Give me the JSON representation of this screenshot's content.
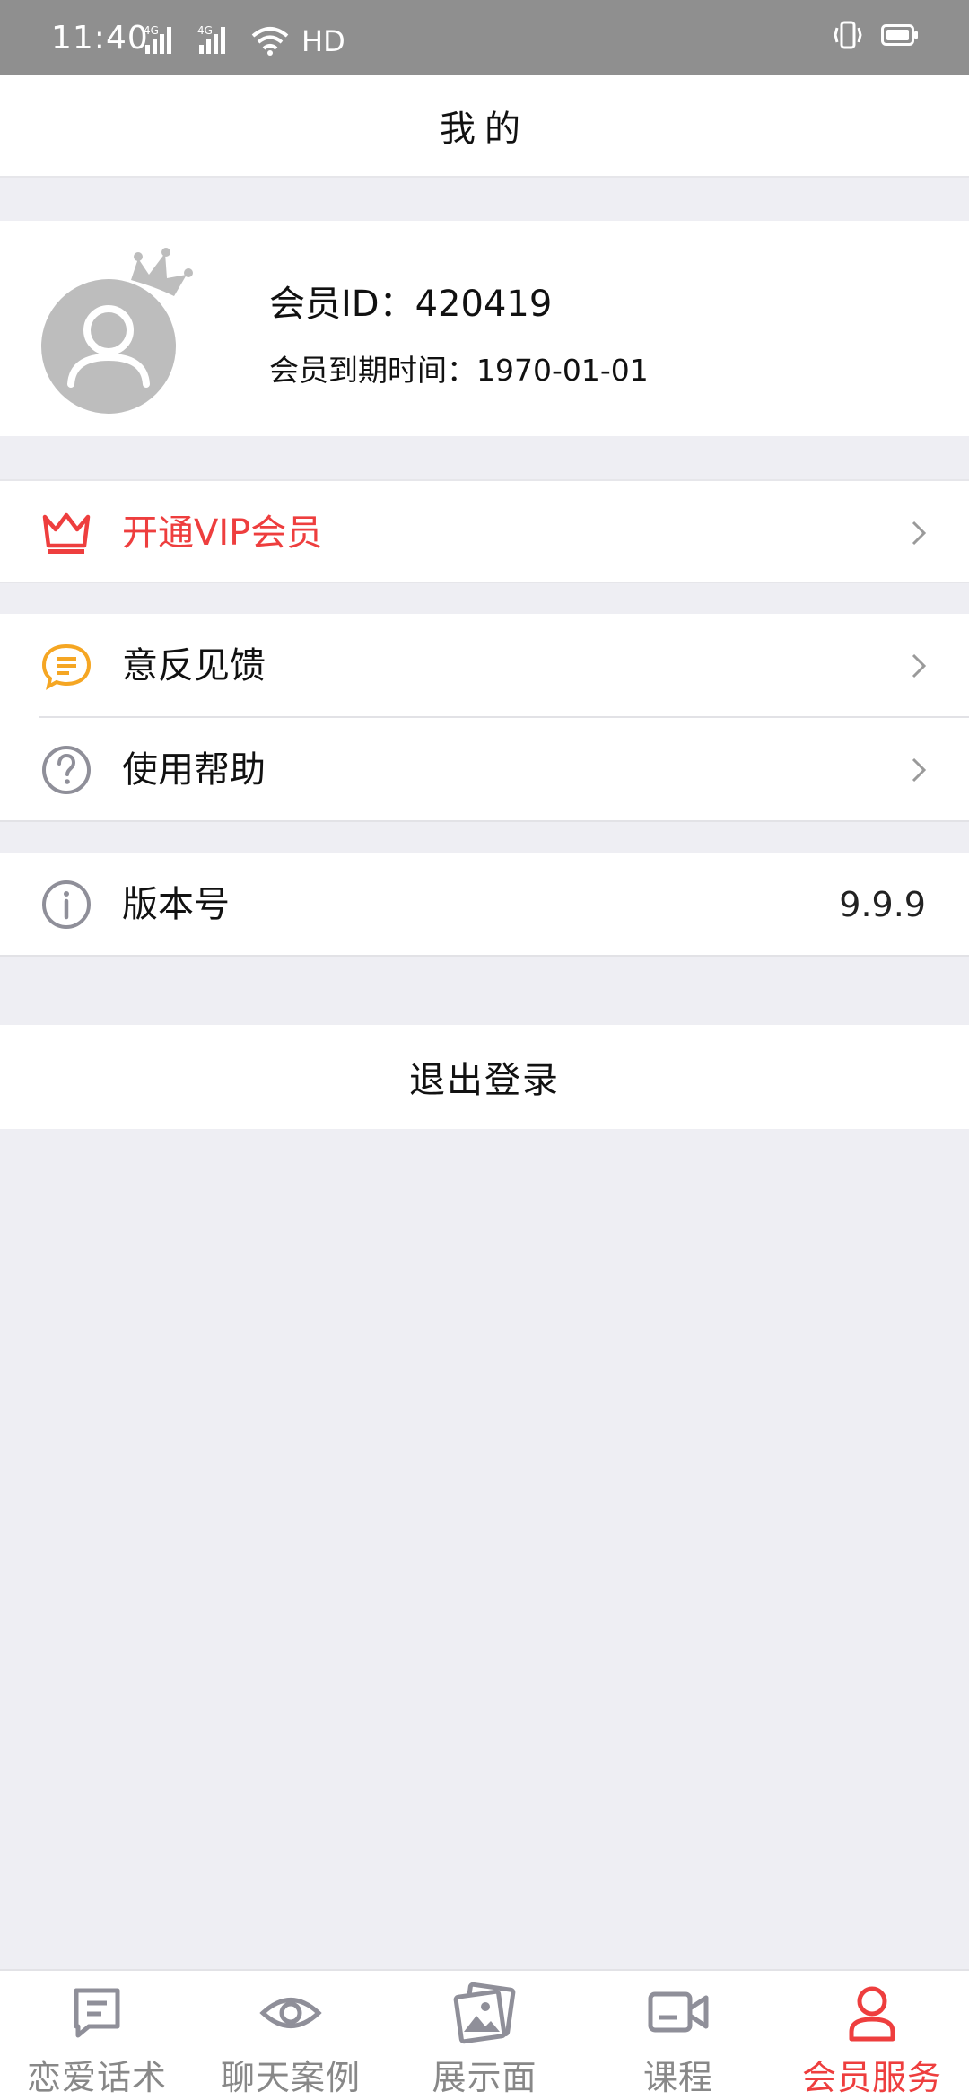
{
  "status_bar": {
    "time": "11:40",
    "network_1": "4G",
    "network_2": "4G",
    "hd": "HD",
    "icons": [
      "signal-icon",
      "signal-icon",
      "wifi-icon",
      "vibrate-icon",
      "battery-icon"
    ]
  },
  "header": {
    "title": "我的"
  },
  "profile": {
    "member_id": "会员ID：420419",
    "expiry": "会员到期时间：1970-01-01",
    "avatar_icon": "avatar-crown-icon"
  },
  "menu": {
    "vip": {
      "label": "开通VIP会员",
      "icon": "crown-icon"
    },
    "feedback": {
      "label": "意反见馈",
      "icon": "chat-bubble-icon"
    },
    "help": {
      "label": "使用帮助",
      "icon": "question-icon"
    },
    "version": {
      "label": "版本号",
      "value": "9.9.9",
      "icon": "info-icon"
    },
    "logout": {
      "label": "退出登录"
    }
  },
  "bottom_nav": {
    "items": [
      {
        "label": "恋爱话术",
        "icon": "message-icon",
        "active": false
      },
      {
        "label": "聊天案例",
        "icon": "eye-icon",
        "active": false
      },
      {
        "label": "展示面",
        "icon": "photos-icon",
        "active": false
      },
      {
        "label": "课程",
        "icon": "video-camera-icon",
        "active": false
      },
      {
        "label": "会员服务",
        "icon": "person-icon",
        "active": true
      }
    ]
  },
  "colors": {
    "accent_red": "#ee3e3e",
    "feedback_yellow": "#f5a623",
    "icon_gray": "#8f8f99",
    "background": "#eeeef3",
    "status_bar": "#8f8f8f"
  }
}
